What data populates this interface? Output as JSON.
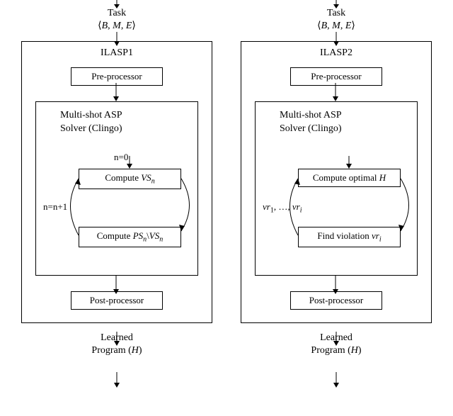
{
  "left": {
    "task_label": "Task",
    "task_tuple": "⟨B, M, E⟩",
    "title": "ILASP1",
    "pre": "Pre-processor",
    "solver_line1": "Multi-shot ASP",
    "solver_line2": "Solver (Clingo)",
    "n0": "n=0",
    "compute_vs": "Compute VSₙ",
    "loop_inc": "n=n+1",
    "compute_ps": "Compute PSₙ\\VSₙ",
    "post": "Post-processor",
    "learned_label": "Learned",
    "learned_prog": "Program (H)"
  },
  "right": {
    "task_label": "Task",
    "task_tuple": "⟨B, M, E⟩",
    "title": "ILASP2",
    "pre": "Pre-processor",
    "solver_line1": "Multi-shot ASP",
    "solver_line2": "Solver (Clingo)",
    "compute_opt": "Compute optimal H",
    "loop_vr": "vr₁, …, vrᵢ",
    "find_vio": "Find violation vrᵢ",
    "post": "Post-processor",
    "learned_label": "Learned",
    "learned_prog": "Program (H)"
  }
}
